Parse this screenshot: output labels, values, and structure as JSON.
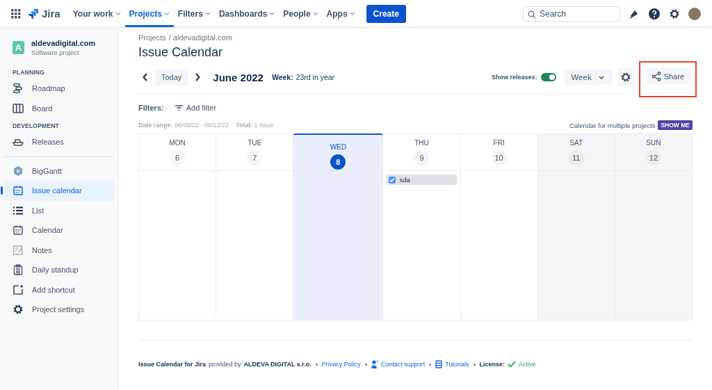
{
  "topnav": {
    "product": "Jira",
    "items": [
      {
        "label": "Your work",
        "selected": false
      },
      {
        "label": "Projects",
        "selected": true
      },
      {
        "label": "Filters",
        "selected": false
      },
      {
        "label": "Dashboards",
        "selected": false
      },
      {
        "label": "People",
        "selected": false
      },
      {
        "label": "Apps",
        "selected": false
      }
    ],
    "create": "Create",
    "search": {
      "placeholder": "Search"
    }
  },
  "sidebar": {
    "project": {
      "initial": "A",
      "name": "aldevadigital.com",
      "type": "Software project"
    },
    "sections": [
      {
        "heading": "PLANNING",
        "items": [
          {
            "label": "Roadmap",
            "kind": "roadmap",
            "selected": false
          },
          {
            "label": "Board",
            "kind": "board",
            "selected": false
          }
        ]
      },
      {
        "heading": "DEVELOPMENT",
        "items": [
          {
            "label": "Releases",
            "kind": "releases",
            "selected": false
          }
        ]
      }
    ],
    "apps": [
      {
        "label": "BigGantt",
        "kind": "gantt",
        "selected": false
      },
      {
        "label": "Issue calendar",
        "kind": "calendar",
        "selected": true
      },
      {
        "label": "List",
        "kind": "list",
        "selected": false
      },
      {
        "label": "Calendar",
        "kind": "calendar",
        "selected": false
      },
      {
        "label": "Notes",
        "kind": "notes",
        "selected": false
      },
      {
        "label": "Daily standup",
        "kind": "standup",
        "selected": false
      },
      {
        "label": "Add shortcut",
        "kind": "shortcut",
        "selected": false
      },
      {
        "label": "Project settings",
        "kind": "settings",
        "selected": false
      }
    ]
  },
  "breadcrumbs": [
    "Projects",
    "/ aldevadigital.com"
  ],
  "title": "Issue Calendar",
  "toolbar": {
    "today": "Today",
    "period": "June 2022",
    "week_label": "Week:",
    "week_value": "23rd in year",
    "releases_label": "Show releases:",
    "releases_on": true,
    "view": "Week",
    "share": "Share",
    "share_highlighted": true
  },
  "filters": {
    "label": "Filters:",
    "add": "Add filter"
  },
  "summary": {
    "range_label": "Date range:",
    "range": "06/06/22 - 06/12/22",
    "total_label": "Total:",
    "total": "1 issue",
    "promo": "Calendar for multiple projects",
    "promo_button": "SHOW ME"
  },
  "days": [
    {
      "weekday": "MON",
      "day": "6",
      "today": false,
      "weekend": false
    },
    {
      "weekday": "TUE",
      "day": "7",
      "today": false,
      "weekend": false
    },
    {
      "weekday": "WED",
      "day": "8",
      "today": true,
      "weekend": false
    },
    {
      "weekday": "THU",
      "day": "9",
      "today": false,
      "weekend": false,
      "events": [
        {
          "title": "sda",
          "checked": true
        }
      ]
    },
    {
      "weekday": "FRI",
      "day": "10",
      "today": false,
      "weekend": false
    },
    {
      "weekday": "SAT",
      "day": "11",
      "today": false,
      "weekend": true
    },
    {
      "weekday": "SUN",
      "day": "12",
      "today": false,
      "weekend": true
    }
  ],
  "footer": {
    "product": "Issue Calendar for Jira",
    "provided": "provided by",
    "company": "ALDEVA DIGITAL s.r.o.",
    "links": [
      {
        "label": "Privacy Policy",
        "kind": "plain"
      },
      {
        "label": "Contact support",
        "kind": "support"
      },
      {
        "label": "Tutorials",
        "kind": "tutorials"
      }
    ],
    "license_label": "License:",
    "license": "Active"
  }
}
